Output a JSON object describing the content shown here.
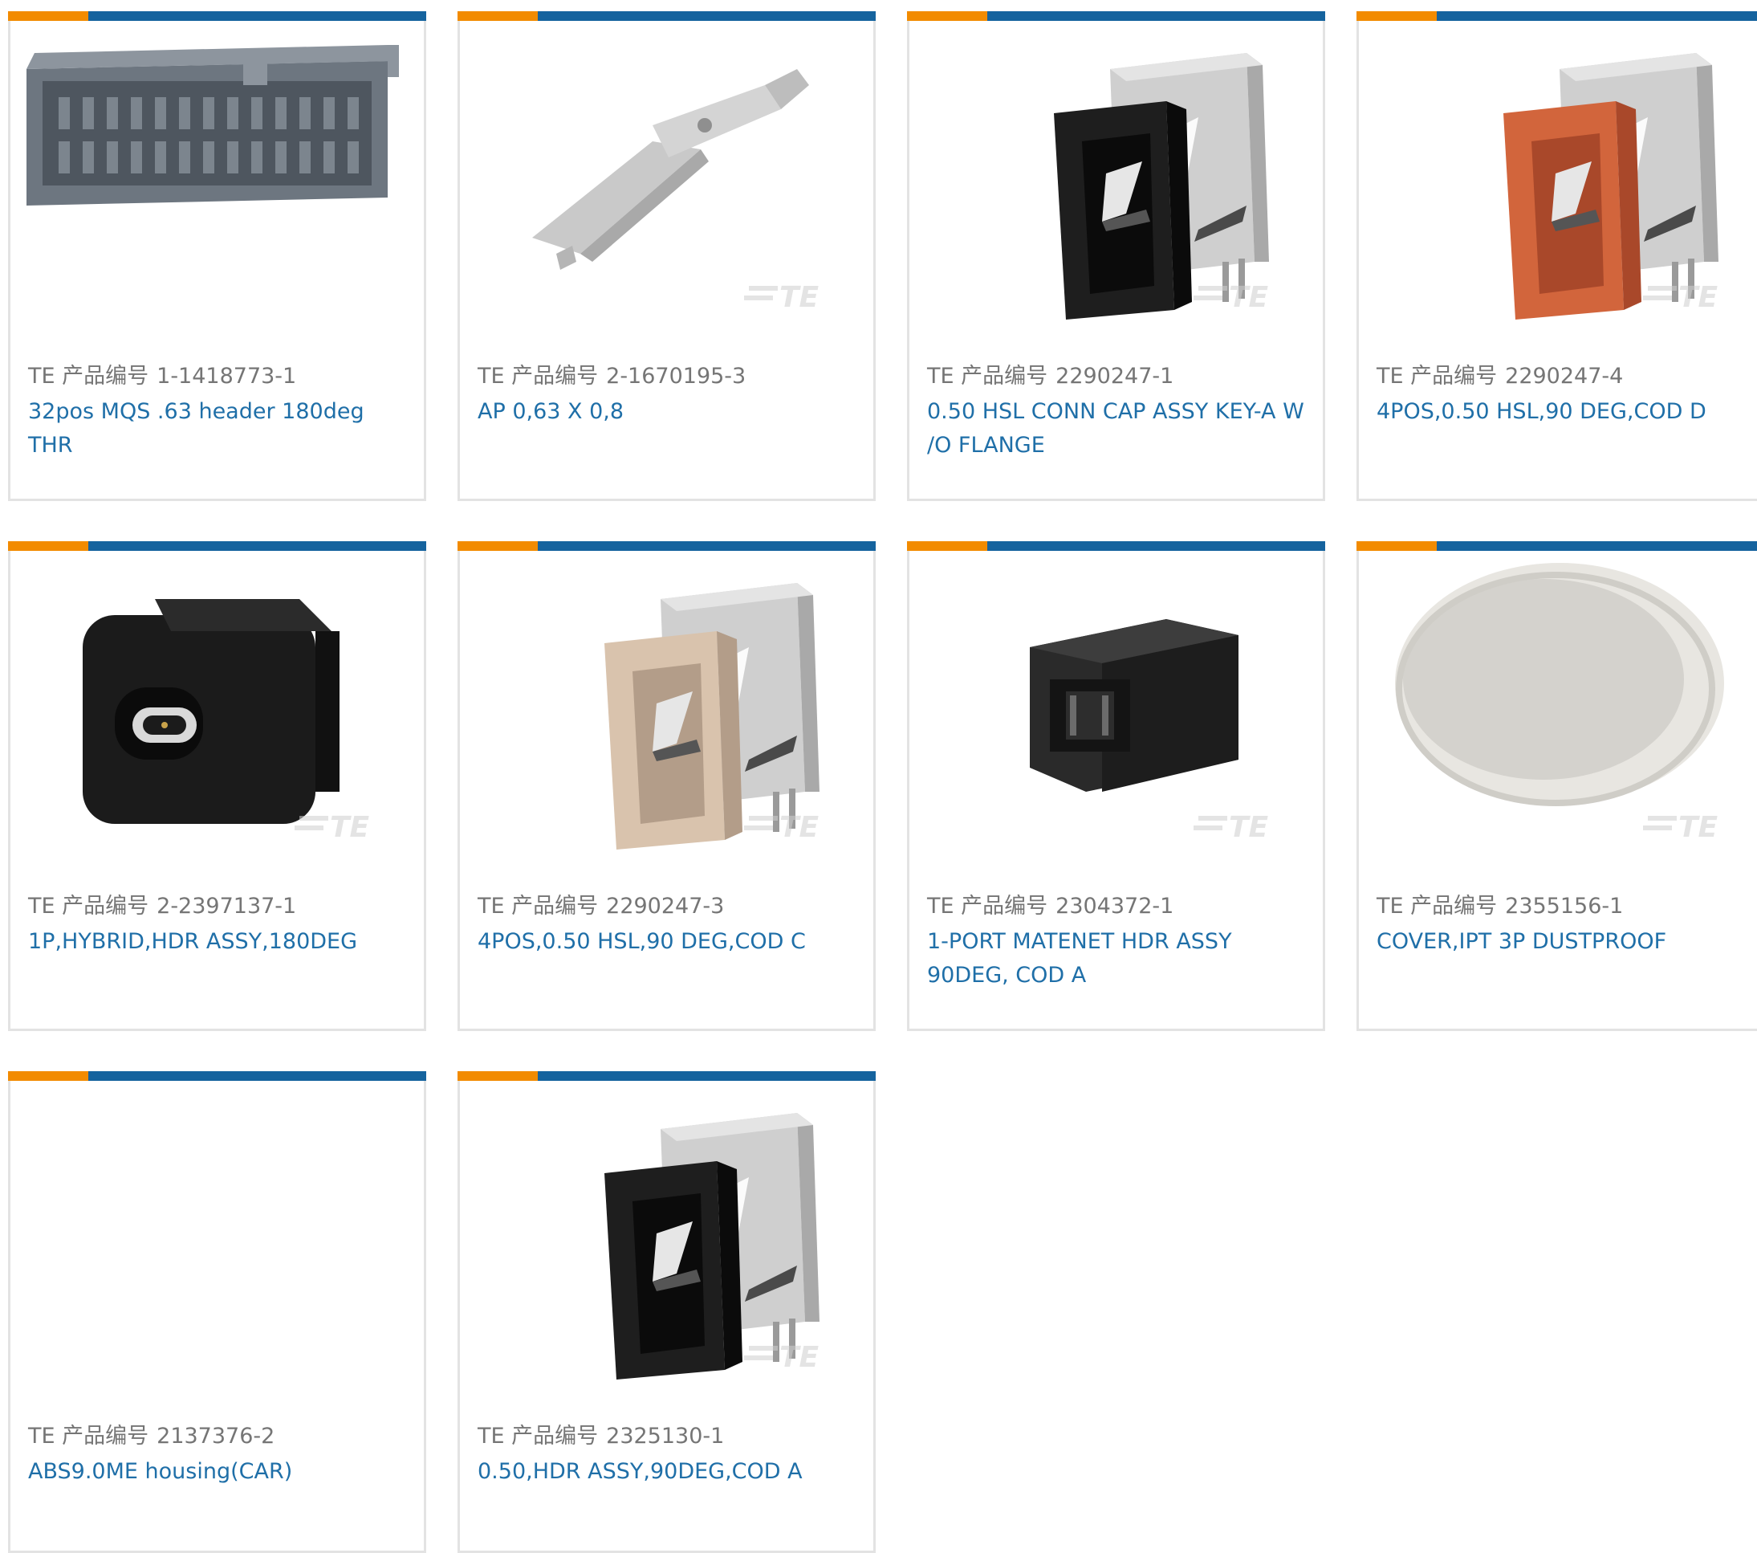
{
  "colors": {
    "accent_orange": "#f28b00",
    "accent_blue": "#15639e",
    "link": "#1f6fa8",
    "muted": "#757575",
    "border": "#e3e3e3"
  },
  "pn_label": "TE 产品编号",
  "watermark": "TE",
  "products": [
    {
      "part_number": "1-1418773-1",
      "description": "32pos MQS .63 header 180deg THR",
      "image": "gray-header-connector"
    },
    {
      "part_number": "2-1670195-3",
      "description": "AP 0,63 X 0,8",
      "image": "metal-contact-pin"
    },
    {
      "part_number": "2290247-1",
      "description": "0.50 HSL CONN CAP ASSY KEY-A W /O FLANGE",
      "image": "black-hsl-connector"
    },
    {
      "part_number": "2290247-4",
      "description": "4POS,0.50 HSL,90 DEG,COD D",
      "image": "orange-hsl-connector"
    },
    {
      "part_number": "2-2397137-1",
      "description": "1P,HYBRID,HDR ASSY,180DEG",
      "image": "black-hybrid-header"
    },
    {
      "part_number": "2290247-3",
      "description": "4POS,0.50 HSL,90 DEG,COD C",
      "image": "beige-hsl-connector"
    },
    {
      "part_number": "2304372-1",
      "description": "1-PORT MATENET HDR ASSY 90DEG, COD A",
      "image": "black-matenet-header"
    },
    {
      "part_number": "2355156-1",
      "description": "COVER,IPT 3P DUSTPROOF",
      "image": "white-dust-cover"
    },
    {
      "part_number": "2137376-2",
      "description": "ABS9.0ME housing(CAR)",
      "image": "no-image"
    },
    {
      "part_number": "2325130-1",
      "description": "0.50,HDR ASSY,90DEG,COD A",
      "image": "black-hsl-connector"
    }
  ]
}
